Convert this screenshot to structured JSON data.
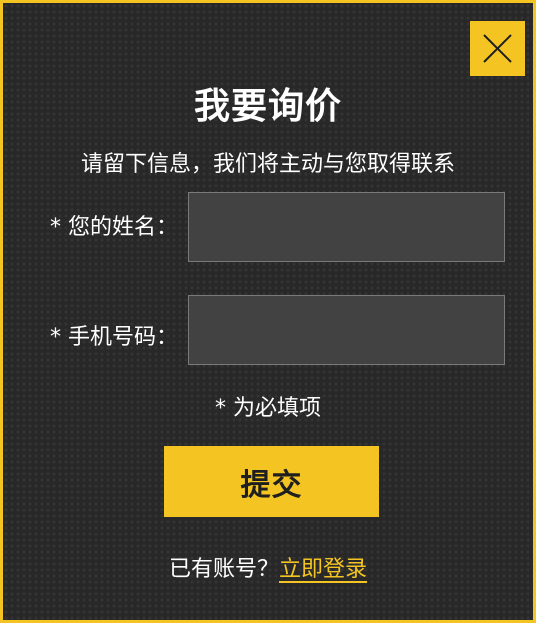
{
  "dialog": {
    "title": "我要询价",
    "subtitle": "请留下信息，我们将主动与您取得联系",
    "close_icon": "close-icon",
    "accent_color": "#f4c522"
  },
  "form": {
    "name_label": "* 您的姓名：",
    "name_value": "",
    "phone_label": "* 手机号码：",
    "phone_value": "",
    "required_note": "* 为必填项",
    "submit_label": "提交"
  },
  "footer": {
    "prompt": "已有账号？",
    "login_link": "立即登录"
  }
}
